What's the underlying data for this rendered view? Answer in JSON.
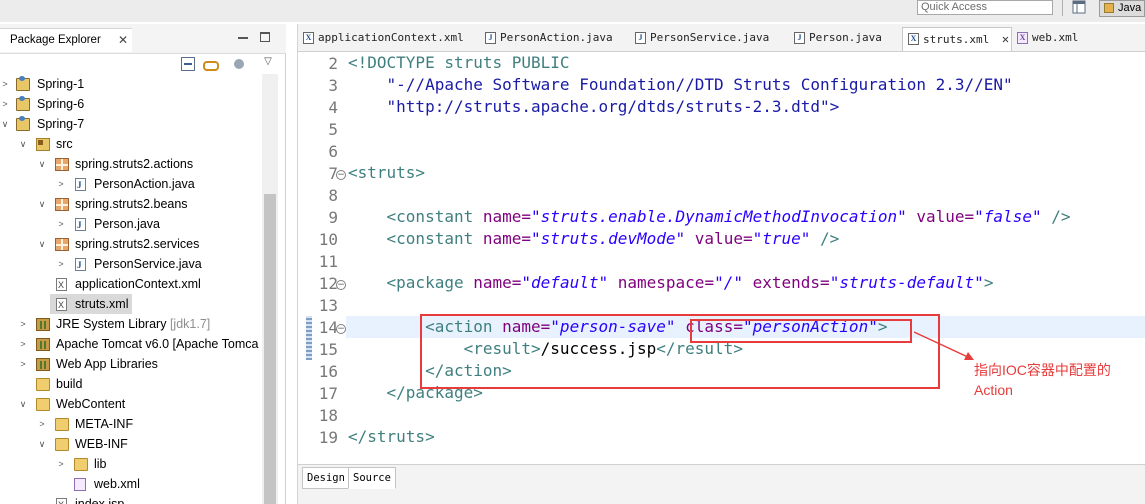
{
  "toolbar": {
    "quick_access_placeholder": "Quick Access",
    "perspective_label": "Java"
  },
  "package_explorer": {
    "title": "Package Explorer",
    "tree": [
      {
        "label": "Spring-1"
      },
      {
        "label": "Spring-6"
      },
      {
        "label": "Spring-7"
      },
      {
        "label": "src"
      },
      {
        "label": "spring.struts2.actions"
      },
      {
        "label": "PersonAction.java"
      },
      {
        "label": "spring.struts2.beans"
      },
      {
        "label": "Person.java"
      },
      {
        "label": "spring.struts2.services"
      },
      {
        "label": "PersonService.java"
      },
      {
        "label": "applicationContext.xml"
      },
      {
        "label": "struts.xml"
      },
      {
        "label": "JRE System Library",
        "suffix": "[jdk1.7]"
      },
      {
        "label": "Apache Tomcat v6.0 [Apache Tomca"
      },
      {
        "label": "Web App Libraries"
      },
      {
        "label": "build"
      },
      {
        "label": "WebContent"
      },
      {
        "label": "META-INF"
      },
      {
        "label": "WEB-INF"
      },
      {
        "label": "lib"
      },
      {
        "label": "web.xml"
      },
      {
        "label": "index.jsp"
      }
    ]
  },
  "editor": {
    "tabs": [
      {
        "label": "applicationContext.xml",
        "icon": "X"
      },
      {
        "label": "PersonAction.java",
        "icon": "J"
      },
      {
        "label": "PersonService.java",
        "icon": "J"
      },
      {
        "label": "Person.java",
        "icon": "J"
      },
      {
        "label": "struts.xml",
        "icon": "X"
      },
      {
        "label": "web.xml",
        "icon": "X"
      }
    ],
    "line_numbers": [
      "2",
      "3",
      "4",
      "5",
      "6",
      "7",
      "8",
      "9",
      "10",
      "11",
      "12",
      "13",
      "14",
      "15",
      "16",
      "17",
      "18",
      "19"
    ],
    "code": {
      "l2_tag": "<!DOCTYPE struts PUBLIC",
      "l3": "    \"-//Apache Software Foundation//DTD Struts Configuration 2.3//EN\"",
      "l4": "    \"http://struts.apache.org/dtds/struts-2.3.dtd\">",
      "l6": "<struts>",
      "l8_open": "    <constant ",
      "l8_name_attr": "name=",
      "l8_name_val": "\"struts.enable.DynamicMethodInvocation\"",
      "l8_value_attr": " value=",
      "l8_value_val": "\"false\"",
      "l8_close": " />",
      "l9_open": "    <constant ",
      "l9_name_attr": "name=",
      "l9_name_val": "\"struts.devMode\"",
      "l9_value_attr": " value=",
      "l9_value_val": "\"true\"",
      "l9_close": " />",
      "l11_open": "    <package ",
      "l11_name_attr": "name=",
      "l11_name_val": "\"default\"",
      "l11_ns_attr": " namespace=",
      "l11_ns_val": "\"/\"",
      "l11_ext_attr": " extends=",
      "l11_ext_val": "\"struts-default\"",
      "l11_close": ">",
      "l13_open": "        <action ",
      "l13_name_attr": "name=",
      "l13_name_val": "\"person-save\"",
      "l13_class_attr": " class=",
      "l13_class_val": "\"personAction\"",
      "l13_close": ">",
      "l14_open": "            <result>",
      "l14_text": "/success.jsp",
      "l14_close": "</result>",
      "l15": "        </action>",
      "l16": "    </package>",
      "l18": "</struts>"
    },
    "annotation": "指向IOC容器中配置的Action",
    "bottom_tabs": [
      "Design",
      "Source"
    ]
  },
  "colors": {
    "annotation_red": "#e83b3b",
    "tag_teal": "#3f7f7f",
    "attr_purple": "#7f007f",
    "value_blue": "#2a00ff"
  }
}
